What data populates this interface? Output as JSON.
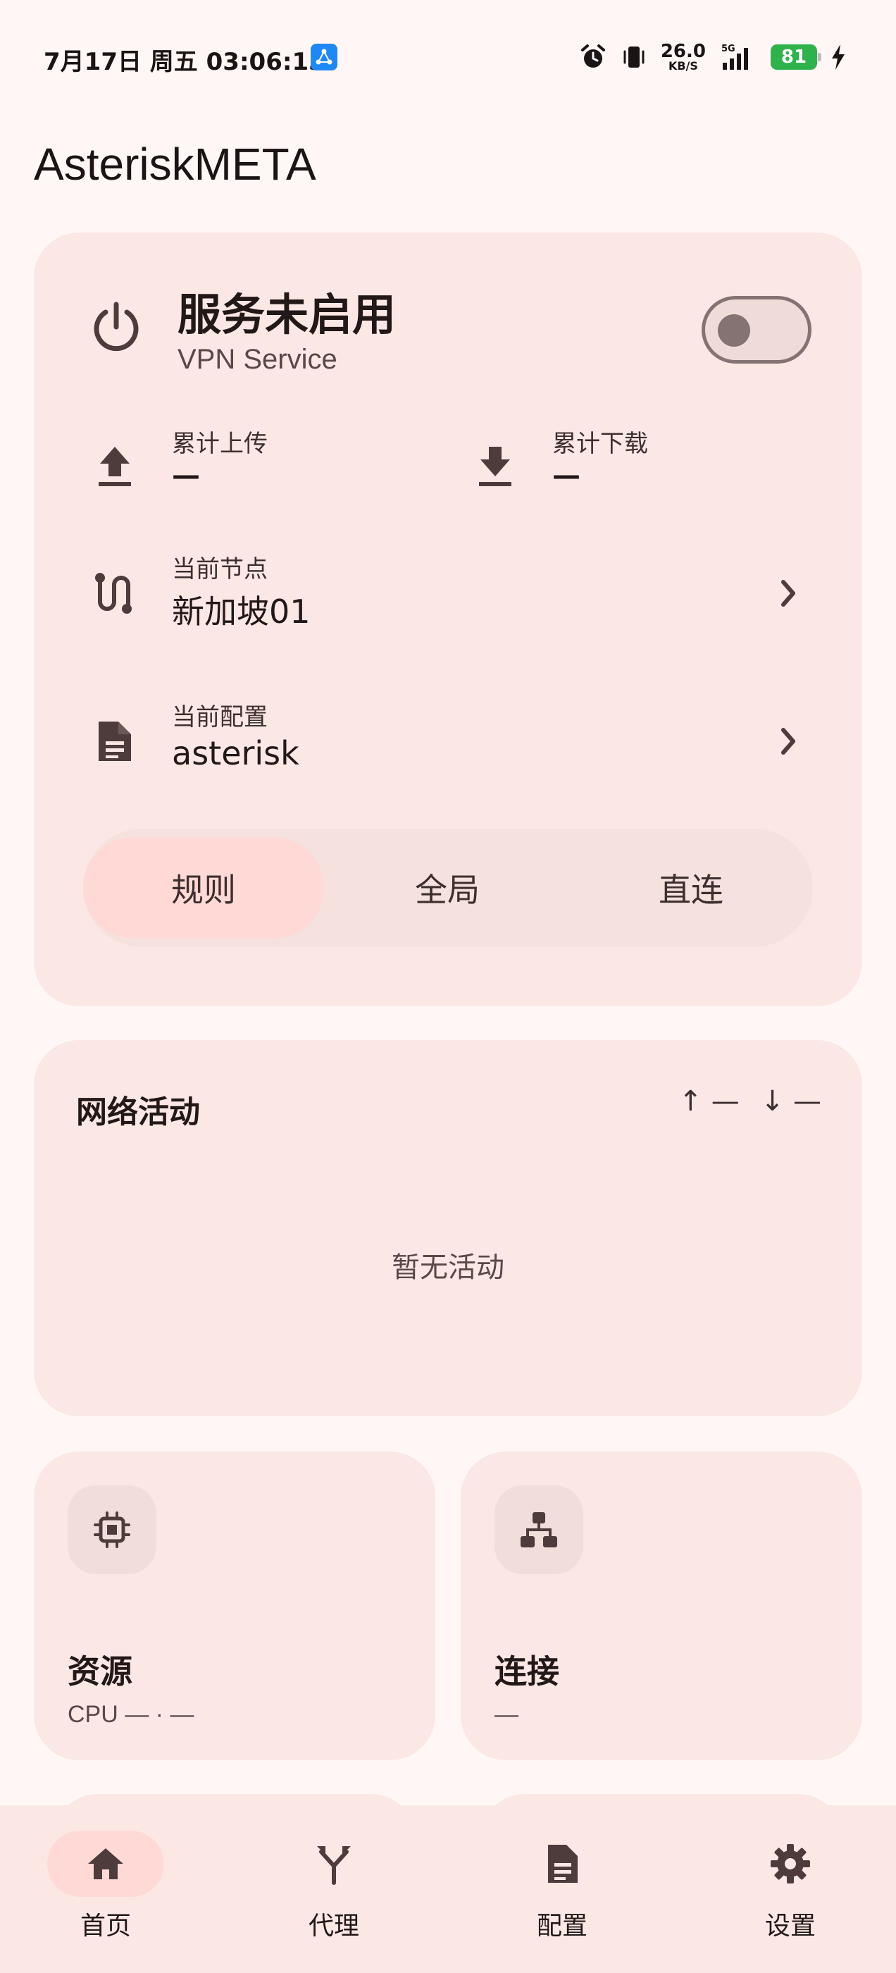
{
  "status_bar": {
    "time": "7月17日 周五 03:06:13",
    "net_speed_value": "26.0",
    "net_speed_unit": "KB/S",
    "battery": "81"
  },
  "app": {
    "title": "AsteriskMETA"
  },
  "service": {
    "title": "服务未启用",
    "subtitle": "VPN Service",
    "toggle_on": false,
    "upload_label": "累计上传",
    "upload_value": "—",
    "download_label": "累计下载",
    "download_value": "—",
    "node_label": "当前节点",
    "node_value": "新加坡01",
    "config_label": "当前配置",
    "config_value": "asterisk",
    "modes": [
      "规则",
      "全局",
      "直连"
    ],
    "active_mode": "规则"
  },
  "activity": {
    "title": "网络活动",
    "up_rate": "↑ —",
    "down_rate": "↓ —",
    "empty_text": "暂无活动"
  },
  "resources": {
    "title": "资源",
    "subtitle": "CPU — · —"
  },
  "connections": {
    "title": "连接",
    "subtitle": "—"
  },
  "nav": {
    "items": [
      "首页",
      "代理",
      "配置",
      "设置"
    ],
    "active": "首页"
  },
  "colors": {
    "background": "#fff7f5",
    "card": "#fbe8e5",
    "accent_container": "#ffd9d6",
    "icon": "#4e3c3c",
    "battery": "#2fb24b"
  }
}
